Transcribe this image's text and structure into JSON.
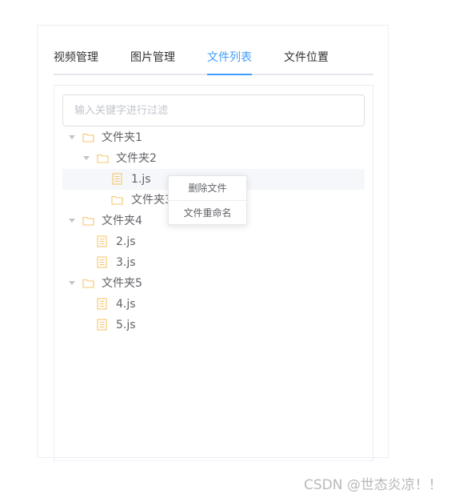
{
  "tabs": [
    {
      "label": "视频管理",
      "active": false
    },
    {
      "label": "图片管理",
      "active": false
    },
    {
      "label": "文件列表",
      "active": true
    },
    {
      "label": "文件位置",
      "active": false
    }
  ],
  "search": {
    "placeholder": "输入关键字进行过滤",
    "value": ""
  },
  "tree": [
    {
      "type": "folder",
      "label": "文件夹1",
      "expanded": true,
      "level": 1,
      "icon": "folder-icon"
    },
    {
      "type": "folder",
      "label": "文件夹2",
      "expanded": true,
      "level": 2,
      "icon": "folder-icon"
    },
    {
      "type": "file",
      "label": "1.js",
      "level": 3,
      "icon": "file-icon",
      "hovered": true
    },
    {
      "type": "folder",
      "label": "文件夹3",
      "level": 3,
      "icon": "folder-icon"
    },
    {
      "type": "folder",
      "label": "文件夹4",
      "expanded": true,
      "level": 1,
      "icon": "folder-icon"
    },
    {
      "type": "file",
      "label": "2.js",
      "level": 2,
      "icon": "file-icon"
    },
    {
      "type": "file",
      "label": "3.js",
      "level": 2,
      "icon": "file-icon"
    },
    {
      "type": "folder",
      "label": "文件夹5",
      "expanded": true,
      "level": 1,
      "icon": "folder-icon"
    },
    {
      "type": "file",
      "label": "4.js",
      "level": 2,
      "icon": "file-icon"
    },
    {
      "type": "file",
      "label": "5.js",
      "level": 2,
      "icon": "file-icon"
    }
  ],
  "context_menu": {
    "items": [
      {
        "label": "删除文件"
      },
      {
        "label": "文件重命名"
      }
    ]
  },
  "watermark": "CSDN @世态炎凉！！",
  "colors": {
    "accent": "#409eff",
    "icon": "#f5c66b",
    "text": "#606266",
    "border": "#dcdfe6"
  }
}
